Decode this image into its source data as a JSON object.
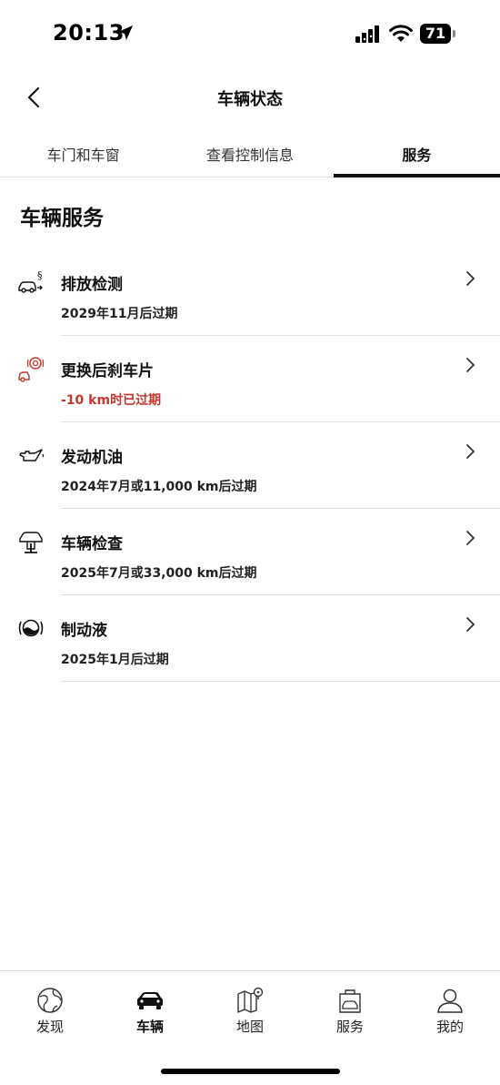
{
  "status_bar": {
    "time": "20:13",
    "battery": "71"
  },
  "header": {
    "title": "车辆状态"
  },
  "tabs": [
    {
      "label": "车门和车窗",
      "active": false
    },
    {
      "label": "查看控制信息",
      "active": false
    },
    {
      "label": "服务",
      "active": true
    }
  ],
  "section": {
    "title": "车辆服务"
  },
  "services": [
    {
      "name": "排放检测",
      "status": "2029年11月后过期",
      "icon": "emission-icon",
      "warning": false
    },
    {
      "name": "更换后刹车片",
      "status": "-10 km时已过期",
      "icon": "brake-pad-icon",
      "warning": true
    },
    {
      "name": "发动机油",
      "status": "2024年7月或11,000 km后过期",
      "icon": "oil-can-icon",
      "warning": false
    },
    {
      "name": "车辆检查",
      "status": "2025年7月或33,000 km后过期",
      "icon": "car-lift-icon",
      "warning": false
    },
    {
      "name": "制动液",
      "status": "2025年1月后过期",
      "icon": "brake-fluid-icon",
      "warning": false
    }
  ],
  "bottom_nav": [
    {
      "label": "发现",
      "icon": "globe-icon",
      "active": false
    },
    {
      "label": "车辆",
      "icon": "car-icon",
      "active": true
    },
    {
      "label": "地图",
      "icon": "map-icon",
      "active": false
    },
    {
      "label": "服务",
      "icon": "service-bag-icon",
      "active": false
    },
    {
      "label": "我的",
      "icon": "profile-icon",
      "active": false
    }
  ],
  "colors": {
    "warning": "#c9362b",
    "text": "#111111",
    "divider": "#e1e1e1"
  }
}
